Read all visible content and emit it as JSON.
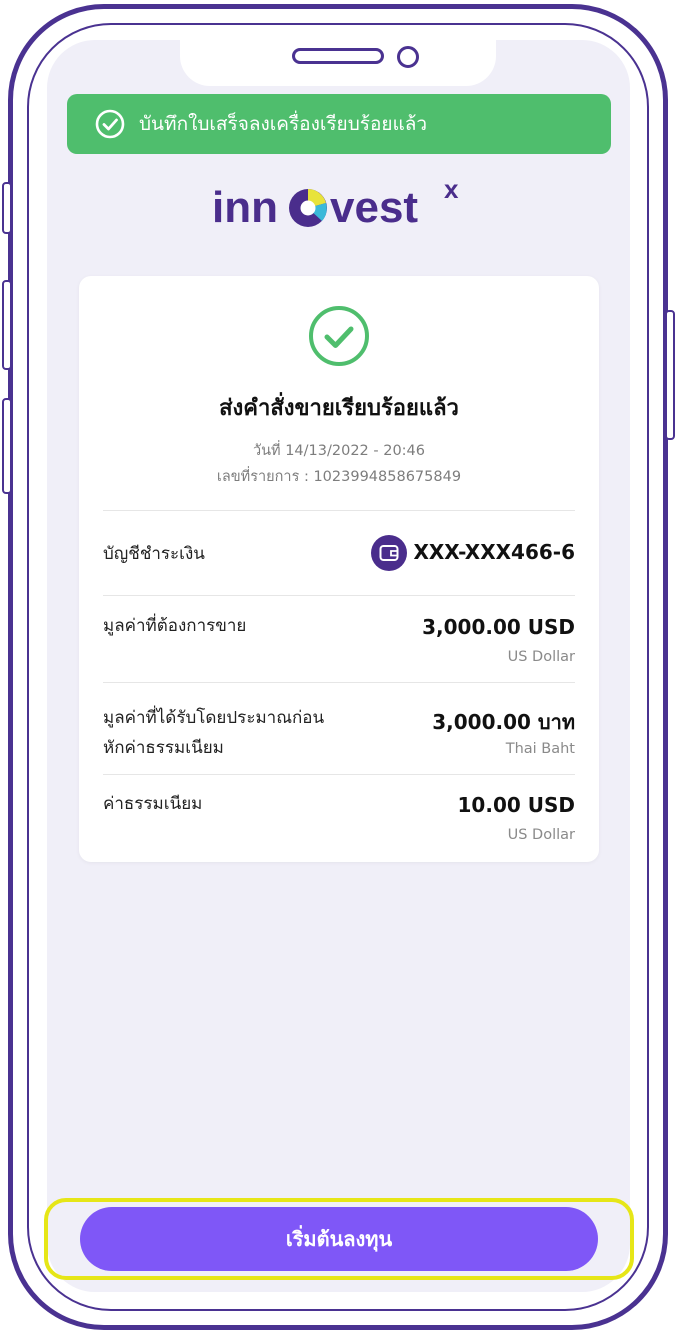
{
  "toast": {
    "message": "บันทึกใบเสร็จลงเครื่องเรียบร้อยแล้ว"
  },
  "brand": {
    "logo_text": "innovest",
    "logo_suffix": "x",
    "primary_color": "#4a2d8c",
    "success_color": "#4fbe6d",
    "cta_color": "#7f57f7"
  },
  "receipt": {
    "title": "ส่งคำสั่งขายเรียบร้อยแล้ว",
    "date_line": "วันที่ 14/13/2022 - 20:46",
    "ref_line": "เลขที่รายการ : 1023994858675849",
    "rows": [
      {
        "label": "บัญชีชำระเงิน",
        "value": "XXX-XXX466-6",
        "icon": "wallet-icon"
      },
      {
        "label": "มูลค่าที่ต้องการขาย",
        "value": "3,000.00 USD",
        "sub": "US Dollar"
      },
      {
        "label_line1": "มูลค่าที่ได้รับโดยประมาณก่อน",
        "label_line2": "หักค่าธรรมเนียม",
        "value": "3,000.00 บาท",
        "sub": "Thai Baht"
      },
      {
        "label": "ค่าธรรมเนียม",
        "value": "10.00 USD",
        "sub": "US Dollar"
      }
    ]
  },
  "cta": {
    "label": "เริ่มต้นลงทุน"
  }
}
